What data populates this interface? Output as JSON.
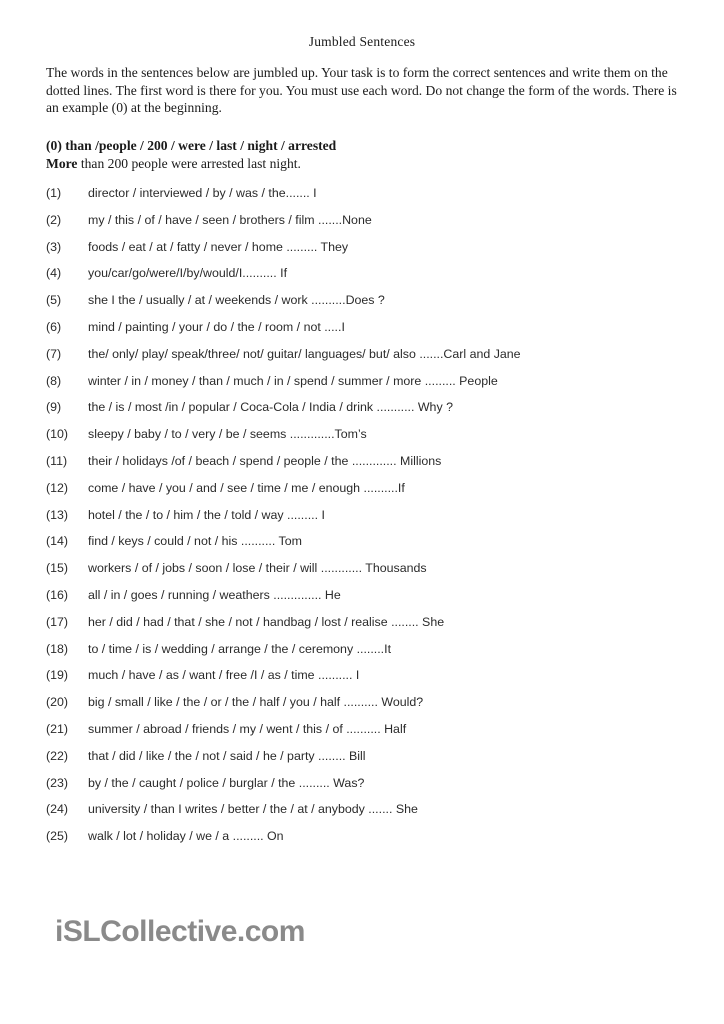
{
  "document": {
    "title": "Jumbled Sentences",
    "instructions": "The words in the sentences below are jumbled up. Your task is to form the correct sentences and write them on the dotted lines. The first word is there for you. You must use each word. Do not change the form of the words. There is an example (0) at the beginning.",
    "example": {
      "prompt": "(0) than /people / 200 / were / last / night / arrested",
      "answer_first_word": "More",
      "answer_rest": " than 200 people were arrested last night."
    },
    "items": [
      {
        "number": "(1)",
        "text": "director / interviewed / by / was / the....... I"
      },
      {
        "number": "(2)",
        "text": "my / this / of / have / seen / brothers / film .......None"
      },
      {
        "number": "(3)",
        "text": "foods / eat / at / fatty / never / home ......... They"
      },
      {
        "number": "(4)",
        "text": "you/car/go/were/I/by/would/I.......... If"
      },
      {
        "number": "(5)",
        "text": "she I the / usually / at / weekends / work ..........Does ?"
      },
      {
        "number": "(6)",
        "text": "mind / painting / your / do / the / room / not .....I"
      },
      {
        "number": "(7)",
        "text": "the/ only/ play/ speak/three/ not/ guitar/ languages/ but/ also .......Carl and Jane"
      },
      {
        "number": "(8)",
        "text": "winter / in / money / than / much / in / spend / summer / more ......... People"
      },
      {
        "number": "(9)",
        "text": "the / is / most /in / popular / Coca-Cola / India / drink ........... Why ?"
      },
      {
        "number": "(10)",
        "text": "sleepy / baby / to / very / be / seems .............Tom’s"
      },
      {
        "number": "(11)",
        "text": "their / holidays /of / beach / spend / people / the ............. Millions"
      },
      {
        "number": "(12)",
        "text": "come / have / you / and / see / time / me / enough ..........If"
      },
      {
        "number": "(13)",
        "text": "hotel / the / to / him / the / told / way ......... I"
      },
      {
        "number": "(14)",
        "text": "find / keys / could / not / his .......... Tom"
      },
      {
        "number": "(15)",
        "text": "workers / of / jobs / soon / lose / their / will ............ Thousands"
      },
      {
        "number": "(16)",
        "text": "all / in / goes / running / weathers .............. He"
      },
      {
        "number": "(17)",
        "text": "her / did / had / that / she / not / handbag / lost / realise ........ She"
      },
      {
        "number": "(18)",
        "text": "to / time / is / wedding / arrange / the / ceremony ........It"
      },
      {
        "number": "(19)",
        "text": "much / have / as / want / free /I / as / time .......... I"
      },
      {
        "number": "(20)",
        "text": "big / small / like / the / or / the / half / you / half .......... Would?"
      },
      {
        "number": "(21)",
        "text": "summer / abroad / friends / my / went / this / of .......... Half"
      },
      {
        "number": "(22)",
        "text": "that / did / like / the / not / said / he / party ........ Bill"
      },
      {
        "number": "(23)",
        "text": "by / the / caught / police / burglar / the ......... Was?"
      },
      {
        "number": "(24)",
        "text": "university / than I writes / better / the / at / anybody ....... She"
      },
      {
        "number": "(25)",
        "text": "walk / lot / holiday / we / a ......... On"
      }
    ],
    "footer": {
      "logo_text": "iSLCollective.com"
    }
  }
}
